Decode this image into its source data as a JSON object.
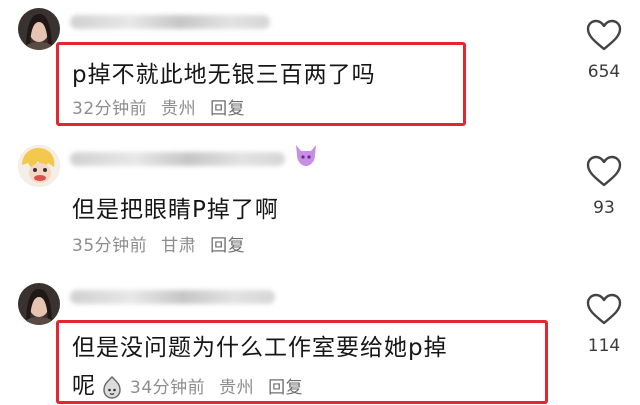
{
  "comments": [
    {
      "text": "p掉不就此地无银三百两了吗",
      "time": "32分钟前",
      "location": "贵州",
      "reply": "回复",
      "likes": "654"
    },
    {
      "text": "但是把眼睛P掉了啊",
      "time": "35分钟前",
      "location": "甘肃",
      "reply": "回复",
      "likes": "93"
    },
    {
      "text_line1": "但是没问题为什么工作室要给她p掉",
      "text_line2": "呢",
      "time": "34分钟前",
      "location": "贵州",
      "reply": "回复",
      "likes": "114"
    }
  ],
  "icons": {
    "like": "heart-outline-icon",
    "emoji": "smiling-blob-emoji-icon",
    "username_badge": "purple-devil-emoji-icon"
  },
  "colors": {
    "highlight": "#e3262f",
    "meta_text": "#8d8d8d",
    "body_text": "#161616"
  }
}
